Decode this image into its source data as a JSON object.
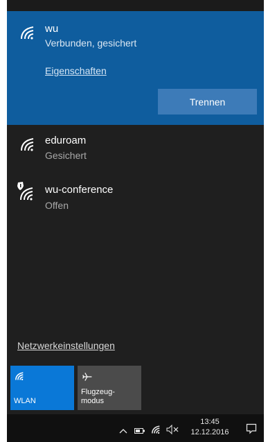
{
  "connected_network": {
    "name": "wu",
    "status": "Verbunden, gesichert",
    "properties_label": "Eigenschaften",
    "disconnect_label": "Trennen"
  },
  "networks": [
    {
      "name": "eduroam",
      "status": "Gesichert",
      "icon": "wifi-icon"
    },
    {
      "name": "wu-conference",
      "status": "Offen",
      "icon": "wifi-open-shield-icon"
    }
  ],
  "settings_link": "Netzwerkeinstellungen",
  "quick_actions": [
    {
      "label": "WLAN",
      "icon": "wifi-icon",
      "active": true
    },
    {
      "label_line1": "Flugzeug-",
      "label_line2": "modus",
      "icon": "airplane-icon",
      "active": false
    }
  ],
  "taskbar": {
    "time": "13:45",
    "date": "12.12.2016"
  },
  "colors": {
    "accent": "#0a78d7",
    "connected_bg": "#0f5d9e",
    "flyout_bg": "#1f1f1f"
  }
}
